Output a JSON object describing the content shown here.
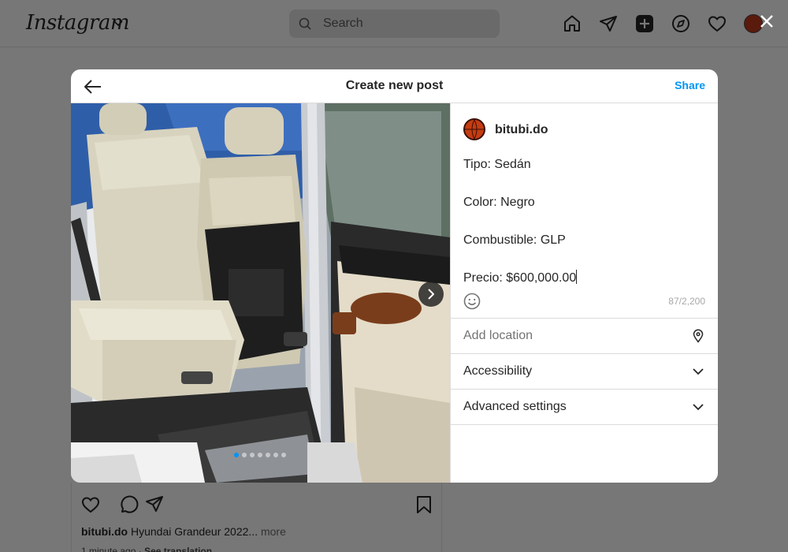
{
  "topbar": {
    "logo": "Instagram",
    "search_placeholder": "Search"
  },
  "modal": {
    "title": "Create new post",
    "share_label": "Share",
    "carousel": {
      "total_slides": 7,
      "active_index": 0
    }
  },
  "post": {
    "username": "bitubi.do",
    "caption_lines": [
      "Tipo: Sedán",
      "Color: Negro",
      "Combustible: GLP",
      "Precio: $600,000.00"
    ],
    "char_count": "87/2,200"
  },
  "settings": {
    "location_placeholder": "Add location",
    "accessibility_label": "Accessibility",
    "advanced_label": "Advanced settings"
  },
  "background_post": {
    "username": "bitubi.do",
    "caption": "Hyundai Grandeur 2022...",
    "more_label": "more",
    "time": "1 minute ago",
    "translation": "See translation"
  },
  "colors": {
    "accent": "#0095f6",
    "overlay": "#777777",
    "text": "#262626",
    "muted": "#737373"
  }
}
